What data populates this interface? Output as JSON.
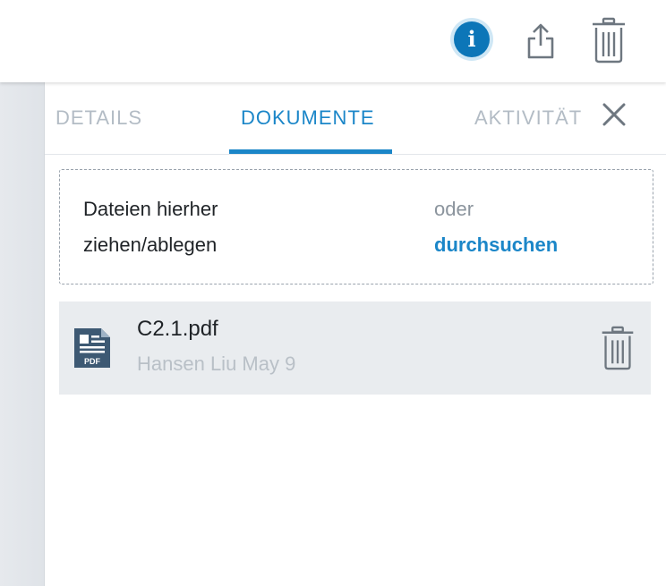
{
  "topbar": {
    "info_icon": "info-icon",
    "info_glyph": "i",
    "share_icon": "share-icon",
    "trash_icon": "trash-icon"
  },
  "tabs": {
    "details": "DETAILS",
    "documents": "DOKUMENTE",
    "activity": "AKTIVITÄT",
    "active": "DOKUMENTE",
    "close_icon": "close-icon"
  },
  "dropzone": {
    "primary": "Dateien hierher ziehen/ablegen",
    "or_text": "oder",
    "browse_link": "durchsuchen"
  },
  "files": [
    {
      "name": "C2.1.pdf",
      "meta": "Hansen Liu May 9",
      "type_label": "PDF",
      "icon": "pdf-file-icon",
      "action_icon": "trash-icon"
    }
  ],
  "colors": {
    "accent": "#1b86c8",
    "info_button": "#0c76b8",
    "icon_gray": "#6e7780",
    "row_background": "#e9ecef"
  }
}
